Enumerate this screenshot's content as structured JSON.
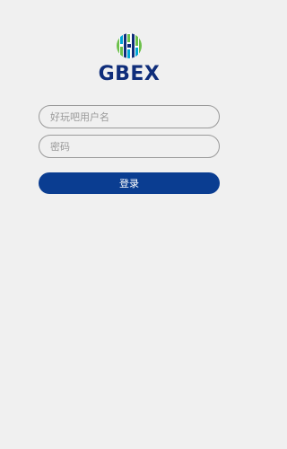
{
  "brand": {
    "name": "GBEX",
    "logo_icon": "gbex-logo-icon",
    "name_color": "#0f2d7a",
    "logo_colors": [
      "#0f2d7a",
      "#6cc04a",
      "#00a6d6"
    ]
  },
  "form": {
    "username_placeholder": "好玩吧用户名",
    "password_placeholder": "密码",
    "login_label": "登录",
    "button_color": "#0a3d91"
  }
}
